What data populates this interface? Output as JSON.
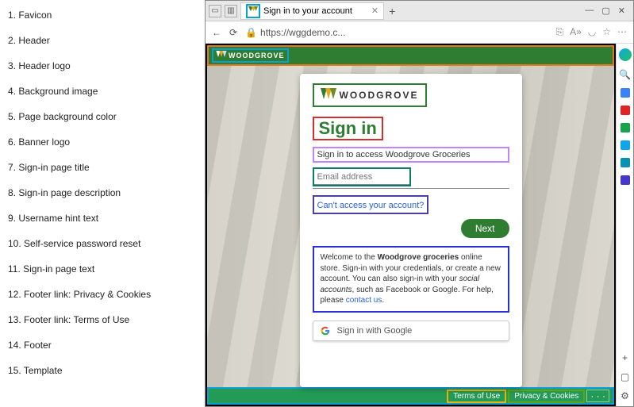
{
  "annotations": [
    "1. Favicon",
    "2. Header",
    "3. Header logo",
    "4. Background image",
    "5. Page background color",
    "6. Banner logo",
    "7. Sign-in page title",
    "8. Sign-in page description",
    "9. Username hint text",
    "10. Self-service password reset",
    "11. Sign-in page text",
    "12. Footer link: Privacy & Cookies",
    "13. Footer link: Terms of Use",
    "14. Footer",
    "15. Template"
  ],
  "tab": {
    "title": "Sign in to your account"
  },
  "address": {
    "url": "https://wggdemo.c..."
  },
  "brand": {
    "name_header": "WOODGROVE",
    "name_banner": "WOODGROVE"
  },
  "signin": {
    "title": "Sign in",
    "description": "Sign in to access Woodgrove Groceries",
    "placeholder": "Email address",
    "sspr": "Can't access your account?",
    "next": "Next",
    "page_text_prefix": "Welcome to the ",
    "page_text_bold1": "Woodgrove groceries",
    "page_text_mid": " online store. Sign-in with your credentials, or create a new account. You can also sign-in with your ",
    "page_text_italic": "social accounts",
    "page_text_suffix": ", such as Facebook or Google. For help, please ",
    "page_text_link": "contact us",
    "page_text_end": ".",
    "google_label": "Sign in with Google"
  },
  "footer": {
    "terms": "Terms of Use",
    "privacy": "Privacy & Cookies",
    "more": "· · ·"
  },
  "window_controls": {
    "min": "—",
    "max": "▢",
    "close": "✕"
  }
}
